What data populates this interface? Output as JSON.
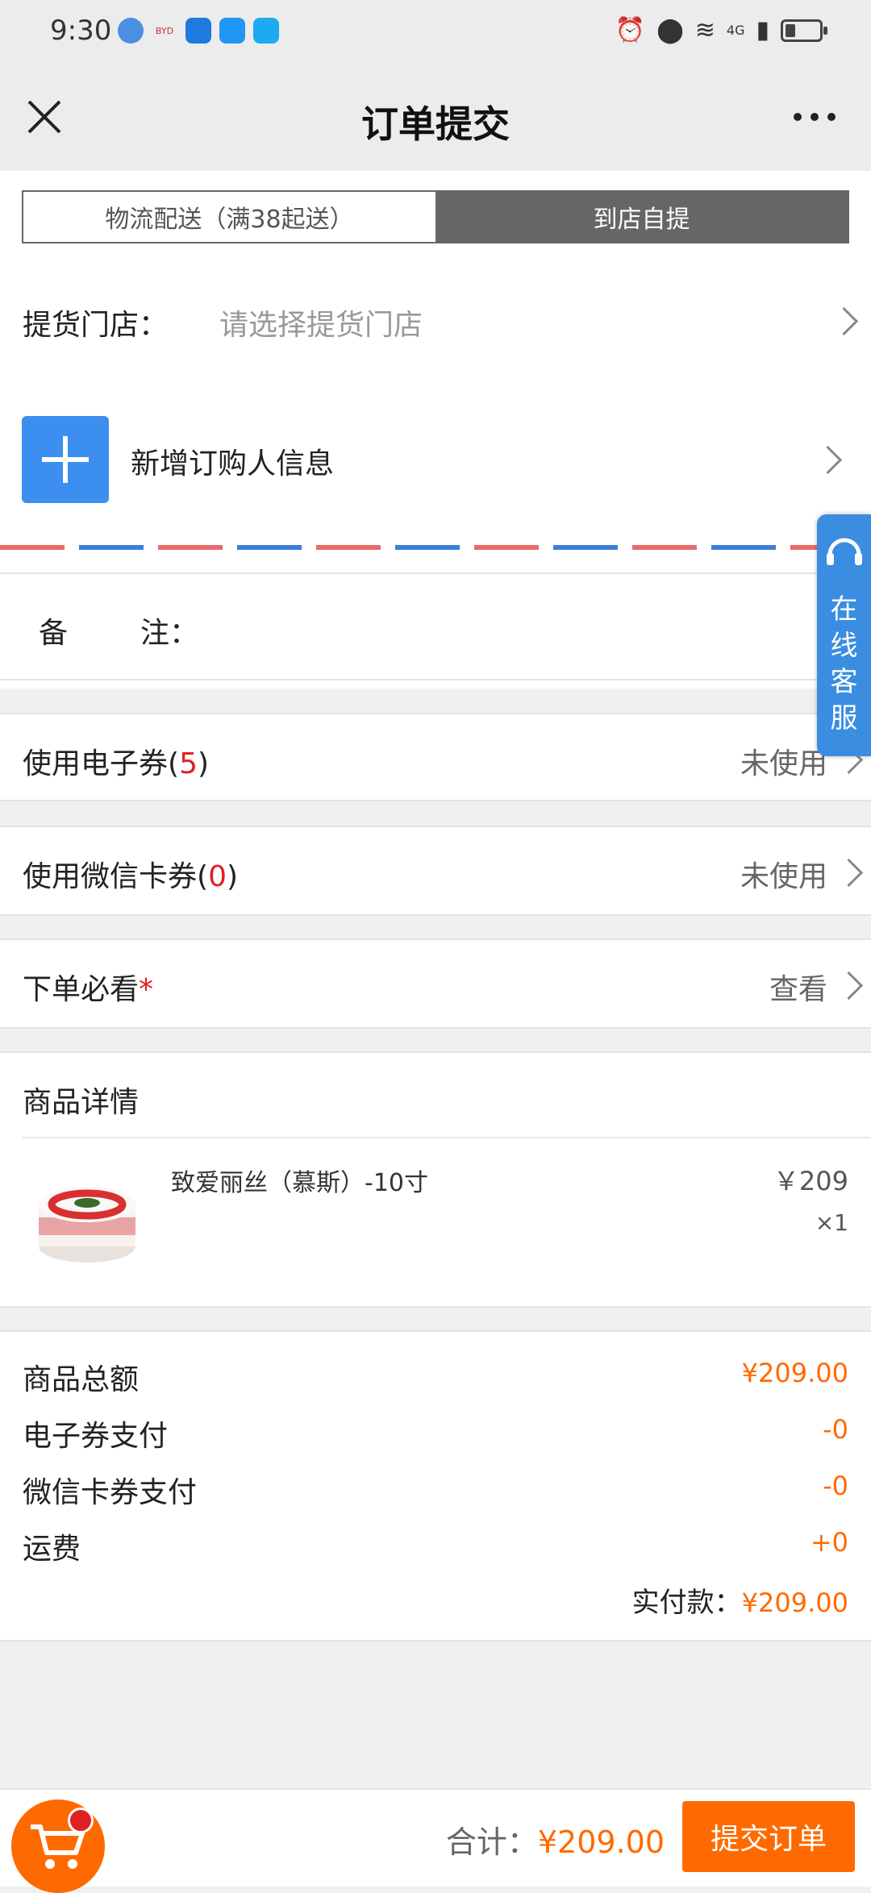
{
  "status_bar": {
    "time": "9:30",
    "right_icons": [
      "alarm-icon",
      "location-icon",
      "wifi-icon",
      "4g-signal-icon",
      "battery-icon"
    ],
    "network": "4G"
  },
  "header": {
    "title": "订单提交",
    "close_icon": "close-icon",
    "more_icon": "more-icon"
  },
  "delivery_tabs": [
    {
      "label": "物流配送（满38起送）",
      "active": false
    },
    {
      "label": "到店自提",
      "active": true
    }
  ],
  "pickup_store": {
    "label": "提货门店：",
    "placeholder": "请选择提货门店"
  },
  "buyer": {
    "add_label": "新增订购人信息"
  },
  "remark": {
    "label_1": "备",
    "label_2": "注："
  },
  "coupons": {
    "ecoupon_label": "使用电子券",
    "ecoupon_count": "5",
    "ecoupon_status": "未使用",
    "wxcard_label": "使用微信卡券",
    "wxcard_count": "0",
    "wxcard_status": "未使用"
  },
  "notice": {
    "label": "下单必看",
    "required_mark": "*",
    "action": "查看"
  },
  "product_section": {
    "title": "商品详情",
    "items": [
      {
        "name": "致爱丽丝（慕斯）-10寸",
        "price": "￥209",
        "qty": "×1"
      }
    ]
  },
  "summary": {
    "total_label": "商品总额",
    "total_value": "¥209.00",
    "ecoupon_pay_label": "电子券支付",
    "ecoupon_pay_value": "-0",
    "wxcard_pay_label": "微信卡券支付",
    "wxcard_pay_value": "-0",
    "shipping_label": "运费",
    "shipping_value": "+0",
    "paid_label": "实付款：",
    "paid_value": "¥209.00"
  },
  "footer": {
    "total_label": "合计：",
    "total_value": "¥209.00",
    "submit_label": "提交订单"
  },
  "service": {
    "label": "在线客服"
  },
  "colors": {
    "accent": "#ff6a00",
    "primary_blue": "#3a8de0",
    "count_red": "#e02020"
  }
}
